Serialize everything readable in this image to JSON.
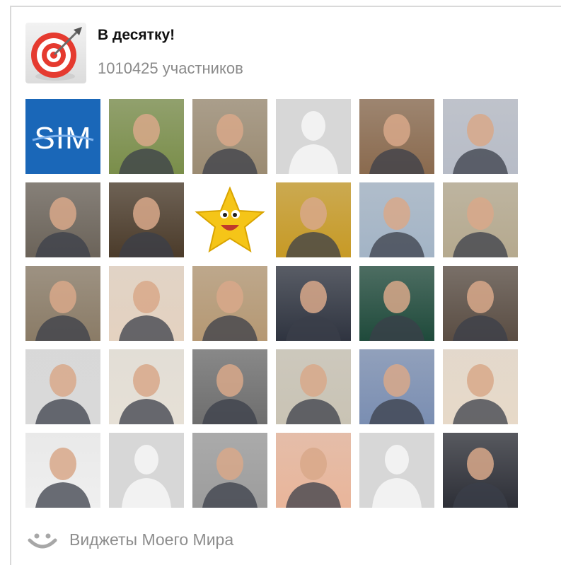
{
  "group": {
    "title": "В десятку!",
    "members_count": "1010425 участников",
    "logo_icon": "target-dart-icon"
  },
  "members": [
    {
      "kind": "sim-logo",
      "text": "SIM"
    },
    {
      "kind": "photo",
      "bg": "#7a8e4a"
    },
    {
      "kind": "photo",
      "bg": "#9b8b72"
    },
    {
      "kind": "placeholder"
    },
    {
      "kind": "photo",
      "bg": "#8a6a4e"
    },
    {
      "kind": "photo",
      "bg": "#b7bcc7"
    },
    {
      "kind": "photo",
      "bg": "#6b6359"
    },
    {
      "kind": "photo",
      "bg": "#4b3b2a"
    },
    {
      "kind": "star"
    },
    {
      "kind": "photo",
      "bg": "#c79a25"
    },
    {
      "kind": "photo",
      "bg": "#a3b4c6"
    },
    {
      "kind": "photo",
      "bg": "#b5a98e"
    },
    {
      "kind": "photo",
      "bg": "#8a7b66"
    },
    {
      "kind": "photo",
      "bg": "#e4d2c0"
    },
    {
      "kind": "photo",
      "bg": "#b59873"
    },
    {
      "kind": "photo",
      "bg": "#2f3440"
    },
    {
      "kind": "photo",
      "bg": "#1f4a3b"
    },
    {
      "kind": "photo",
      "bg": "#5a4d43"
    },
    {
      "kind": "photo",
      "bg": "#d9d9d9"
    },
    {
      "kind": "photo",
      "bg": "#e6e0d6"
    },
    {
      "kind": "photo",
      "bg": "#6e6e6e"
    },
    {
      "kind": "photo",
      "bg": "#c9c3b4"
    },
    {
      "kind": "photo",
      "bg": "#7a8eb2"
    },
    {
      "kind": "photo",
      "bg": "#e7d9c8"
    },
    {
      "kind": "photo",
      "bg": "#efefef"
    },
    {
      "kind": "placeholder"
    },
    {
      "kind": "photo",
      "bg": "#9c9c9c"
    },
    {
      "kind": "photo",
      "bg": "#e9b59a"
    },
    {
      "kind": "placeholder"
    },
    {
      "kind": "photo",
      "bg": "#2d2f37"
    }
  ],
  "footer": {
    "label": "Виджеты Моего Мира",
    "icon": "smile-icon"
  },
  "colors": {
    "border": "#d9d9d9",
    "muted_text": "#8a8a8a",
    "placeholder_bg": "#d7d7d7",
    "placeholder_fg": "#f2f2f2",
    "sim_blue": "#1a67b8"
  }
}
